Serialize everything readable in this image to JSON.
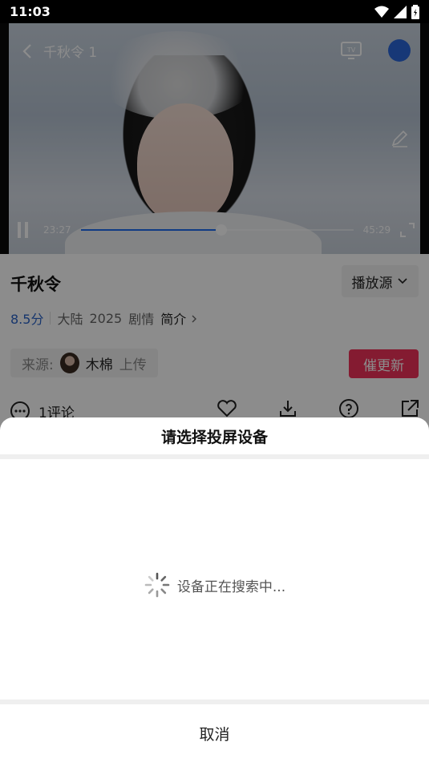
{
  "status_bar": {
    "time": "11:03"
  },
  "player": {
    "episode_title": "千秋令 1",
    "current_time": "23:27",
    "total_time": "45:29",
    "progress": 0.515
  },
  "show": {
    "title": "千秋令",
    "source_button": "播放源",
    "score": "8.5分",
    "region": "大陆",
    "year": "2025",
    "genre": "剧情",
    "intro_link": "简介",
    "source_label": "来源:",
    "uploader_name": "木棉",
    "uploader_suffix": "上传",
    "urge_button": "催更新",
    "comments": "1评论"
  },
  "cast_sheet": {
    "title": "请选择投屏设备",
    "searching_text": "设备正在搜索中...",
    "cancel_label": "取消"
  },
  "colors": {
    "accent_blue": "#1e6cf0",
    "score_blue": "#2a63c7",
    "urge_red": "#f0325a",
    "overlay": "rgba(0,0,0,0.45)"
  },
  "icons": [
    "back-icon",
    "cast-tv-icon",
    "user-avatar-icon",
    "edit-icon",
    "pause-icon",
    "fullscreen-icon",
    "chevron-down-icon",
    "chevron-right-icon",
    "comment-icon",
    "favorite-icon",
    "download-icon",
    "help-icon",
    "share-icon",
    "loading-spinner-icon",
    "wifi-icon",
    "signal-icon",
    "battery-icon"
  ]
}
